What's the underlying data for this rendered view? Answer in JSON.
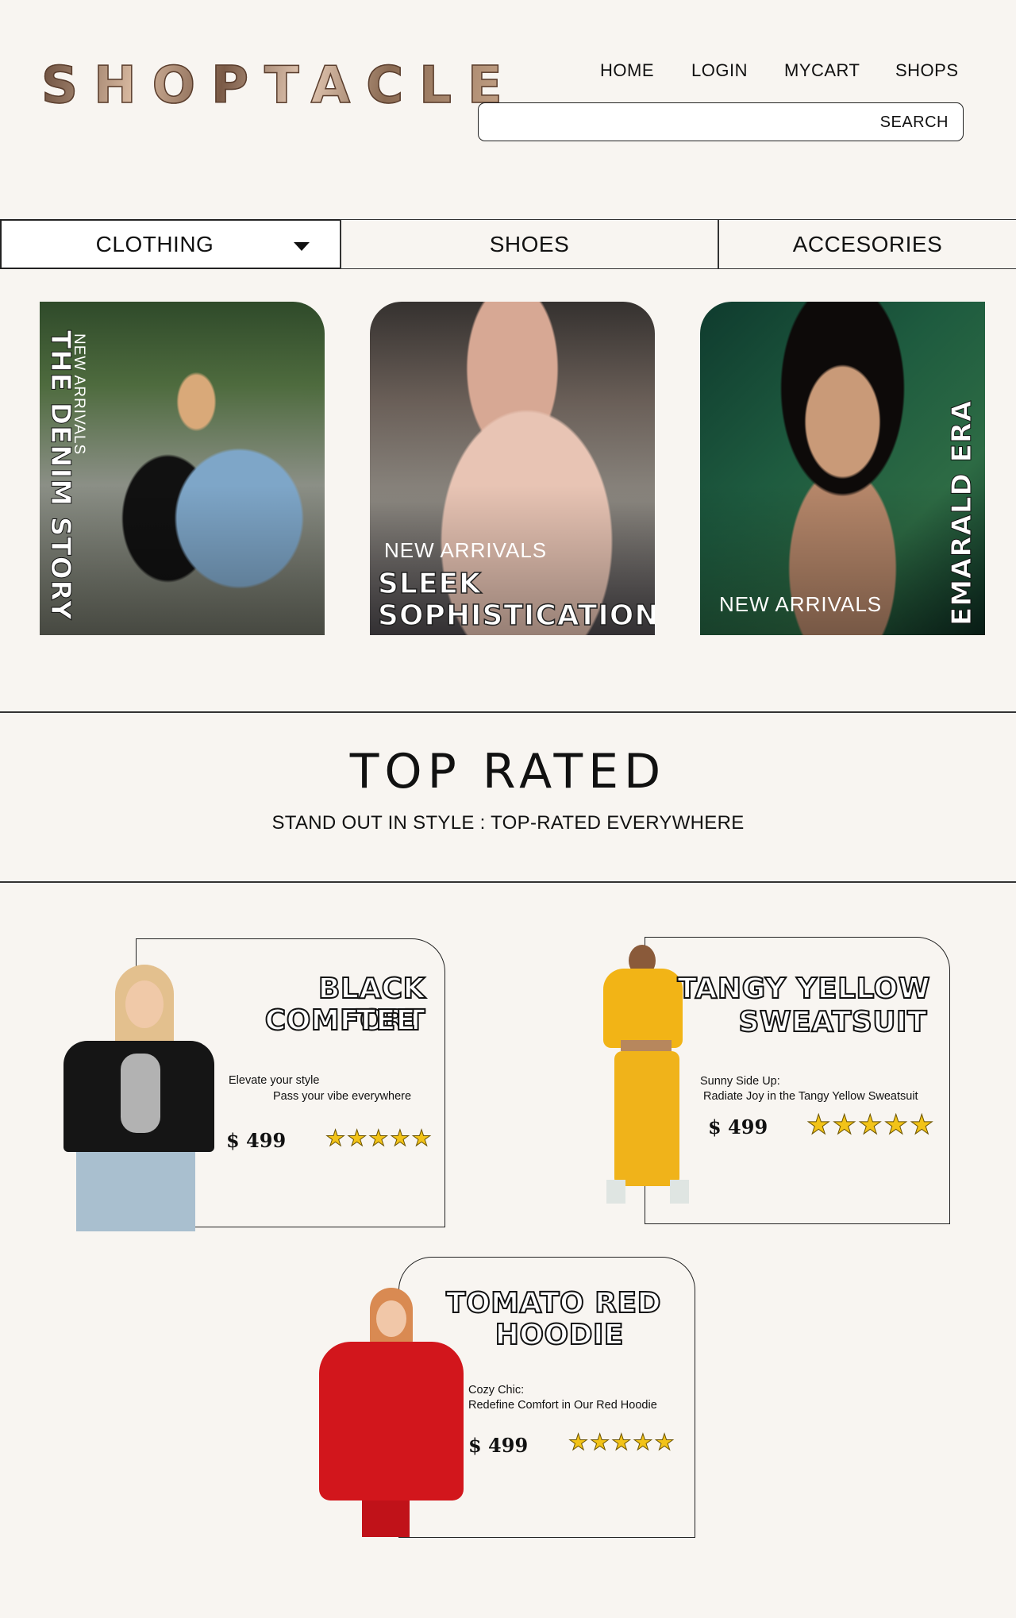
{
  "header": {
    "logo": "SHOPTACLE",
    "nav": [
      "HOME",
      "LOGIN",
      "MYCART",
      "SHOPS"
    ],
    "search": {
      "placeholder": "",
      "button": "SEARCH"
    }
  },
  "categories": {
    "items": [
      "CLOTHING",
      "SHOES",
      "ACCESORIES"
    ],
    "selected": "CLOTHING"
  },
  "banners": [
    {
      "tag": "NEW ARRIVALS",
      "title": "THE DENIM STORY"
    },
    {
      "tag": "NEW ARRIVALS",
      "title_line1": "SLEEK",
      "title_line2": "SOPHISTICATION"
    },
    {
      "tag": "NEW ARRIVALS",
      "title": "EMARALD ERA"
    }
  ],
  "top_rated": {
    "title": "TOP RATED",
    "subtitle": "STAND OUT IN STYLE : TOP-RATED EVERYWHERE"
  },
  "products": [
    {
      "name_line1": "BLACK COMFORT",
      "name_line2": "TEE",
      "desc_line1": "Elevate your style",
      "desc_line2": "Pass your vibe everywhere",
      "price": "$ 499",
      "rating": 5
    },
    {
      "name_line1": "TANGY YELLOW",
      "name_line2": "SWEATSUIT",
      "desc_line1": "Sunny Side Up:",
      "desc_line2": "Radiate Joy in the Tangy Yellow Sweatsuit",
      "price": "$ 499",
      "rating": 5
    },
    {
      "name_line1": "TOMATO RED",
      "name_line2": "HOODIE",
      "desc_line1": "Cozy Chic:",
      "desc_line2": "Redefine Comfort in Our Red Hoodie",
      "price": "$ 499",
      "rating": 5
    }
  ],
  "colors": {
    "background": "#f8f5f1",
    "star": "#f2c318",
    "tee": "#111111",
    "sweatsuit": "#f2b416",
    "hoodie": "#d2161c"
  },
  "icons": {
    "dropdown": "caret-down-icon",
    "rating": "star-icon"
  }
}
